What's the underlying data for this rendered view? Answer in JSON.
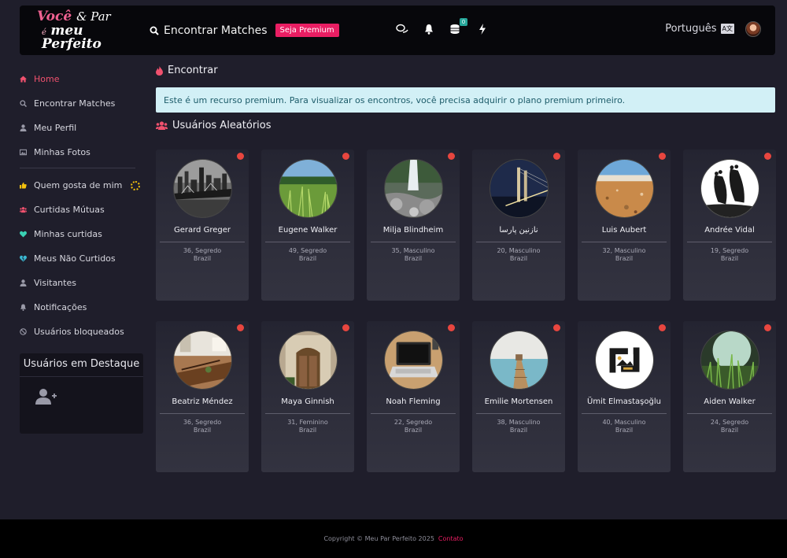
{
  "header": {
    "logo": {
      "line1_a": "Você",
      "line1_b": "& Par",
      "line2_a": "é",
      "line2_b": "meu Perfeito"
    },
    "search_label": "Encontrar Matches",
    "premium_button": "Seja Premium",
    "language": "Português",
    "language_badge": "A文",
    "coins_badge": "0",
    "icons": [
      "chat-icon",
      "bell-icon",
      "coins-icon",
      "bolt-icon"
    ]
  },
  "sidebar": {
    "items": [
      {
        "label": "Home",
        "icon": "home-icon",
        "active": true
      },
      {
        "label": "Encontrar Matches",
        "icon": "search-icon"
      },
      {
        "label": "Meu Perfil",
        "icon": "user-icon"
      },
      {
        "label": "Minhas Fotos",
        "icon": "photo-icon"
      }
    ],
    "items2": [
      {
        "label": "Quem gosta de mim",
        "icon": "thumbs-up-icon"
      },
      {
        "label": "Curtidas Mútuas",
        "icon": "users-icon"
      },
      {
        "label": "Minhas curtidas",
        "icon": "heart-icon"
      },
      {
        "label": "Meus Não Curtidos",
        "icon": "broken-heart-icon"
      },
      {
        "label": "Visitantes",
        "icon": "user-icon"
      },
      {
        "label": "Notificações",
        "icon": "bell-icon"
      },
      {
        "label": "Usuários bloqueados",
        "icon": "ban-icon"
      }
    ],
    "featured_title": "Usuários em Destaque"
  },
  "main": {
    "title": "Encontrar",
    "alert": "Este é um recurso premium. Para visualizar os encontros, você precisa adquirir o plano premium primeiro.",
    "users_title": "Usuários Aleatórios",
    "users": [
      {
        "name": "Gerard Greger",
        "meta1": "36, Segredo",
        "meta2": "Brazil",
        "pic": "city"
      },
      {
        "name": "Eugene Walker",
        "meta1": "49, Segredo",
        "meta2": "Brazil",
        "pic": "grass"
      },
      {
        "name": "Milja Blindheim",
        "meta1": "35, Masculino",
        "meta2": "Brazil",
        "pic": "waterfall"
      },
      {
        "name": "نازنین پارسا",
        "meta1": "20, Masculino",
        "meta2": "Brazil",
        "pic": "bridge"
      },
      {
        "name": "Luis Aubert",
        "meta1": "32, Masculino",
        "meta2": "Brazil",
        "pic": "sand"
      },
      {
        "name": "Andrée Vidal",
        "meta1": "19, Segredo",
        "meta2": "Brazil",
        "pic": "feet"
      },
      {
        "name": "Beatriz Méndez",
        "meta1": "36, Segredo",
        "meta2": "Brazil",
        "pic": "room"
      },
      {
        "name": "Maya Ginnish",
        "meta1": "31, Feminino",
        "meta2": "Brazil",
        "pic": "door"
      },
      {
        "name": "Noah Fleming",
        "meta1": "22, Segredo",
        "meta2": "Brazil",
        "pic": "laptop"
      },
      {
        "name": "Emilie Mortensen",
        "meta1": "38, Masculino",
        "meta2": "Brazil",
        "pic": "pier"
      },
      {
        "name": "Ümit Elmastaşoğlu",
        "meta1": "40, Masculino",
        "meta2": "Brazil",
        "pic": "placeholder"
      },
      {
        "name": "Aiden Walker",
        "meta1": "24, Segredo",
        "meta2": "Brazil",
        "pic": "grass2"
      }
    ]
  },
  "footer": {
    "copyright": "Copyright © Meu Par Perfeito 2025",
    "contact": "Contato"
  },
  "colors": {
    "accent": "#e91e63",
    "alert_bg": "#d2f0f6",
    "status_dot": "#e8463f"
  }
}
